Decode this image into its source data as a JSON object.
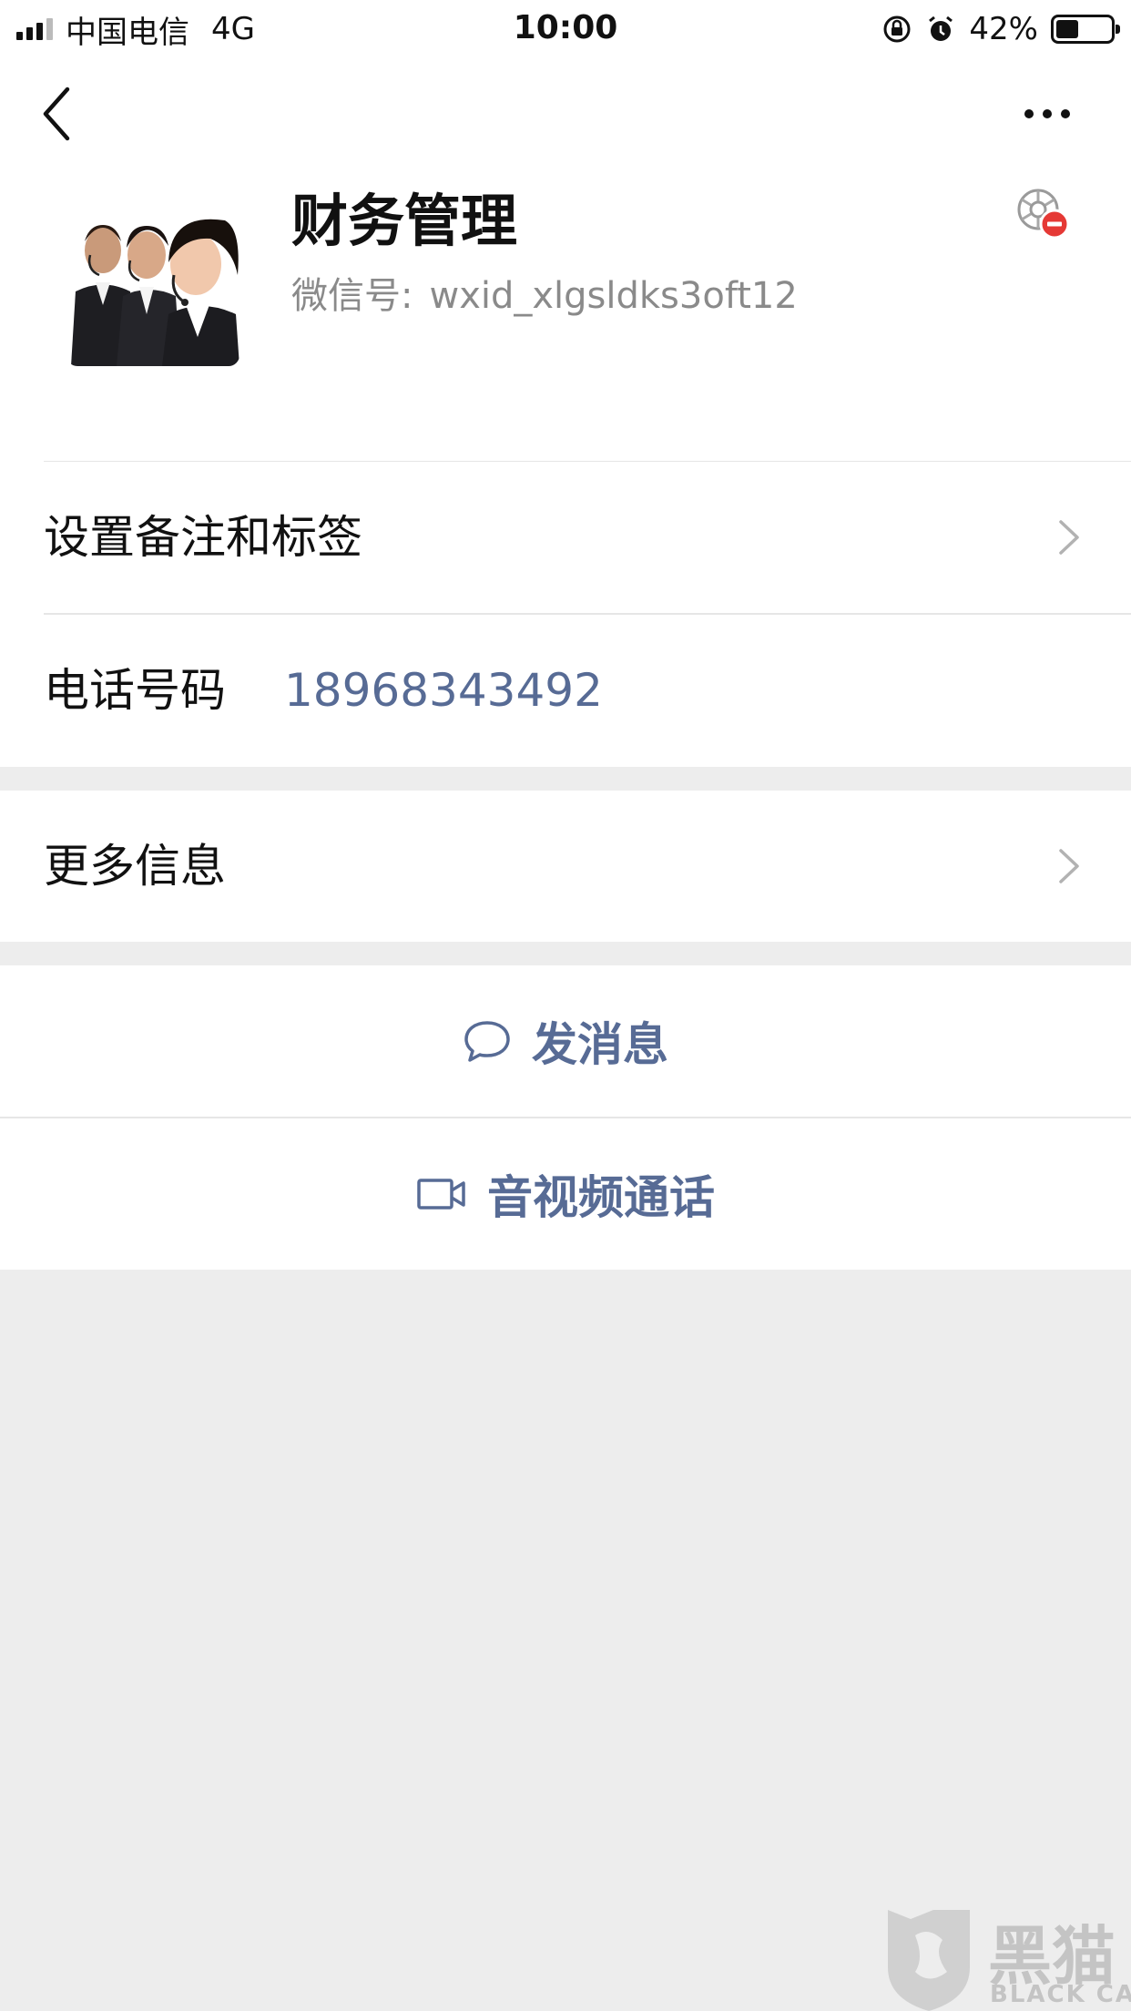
{
  "status_bar": {
    "carrier": "中国电信",
    "network": "4G",
    "time": "10:00",
    "battery": "42%",
    "battery_level": 0.42
  },
  "nav": {
    "back_icon": "chevron-left-icon",
    "more_icon": "ellipsis-icon"
  },
  "profile": {
    "name": "财务管理",
    "wxid_label": "微信号:",
    "wxid_value": "wxid_xlgsldks3oft12",
    "status_icon": "moments-blocked-icon"
  },
  "rows": {
    "remark_label": "设置备注和标签",
    "phone_label": "电话号码",
    "phone_value": "18968343492",
    "more_info_label": "更多信息"
  },
  "actions": {
    "message_label": "发消息",
    "call_label": "音视频通话"
  },
  "watermark": {
    "text": "黑猫",
    "sub": "BLACK CAT"
  },
  "colors": {
    "link": "#576b95",
    "background": "#ededed",
    "card": "#ffffff",
    "status_badge": "#e53935"
  }
}
